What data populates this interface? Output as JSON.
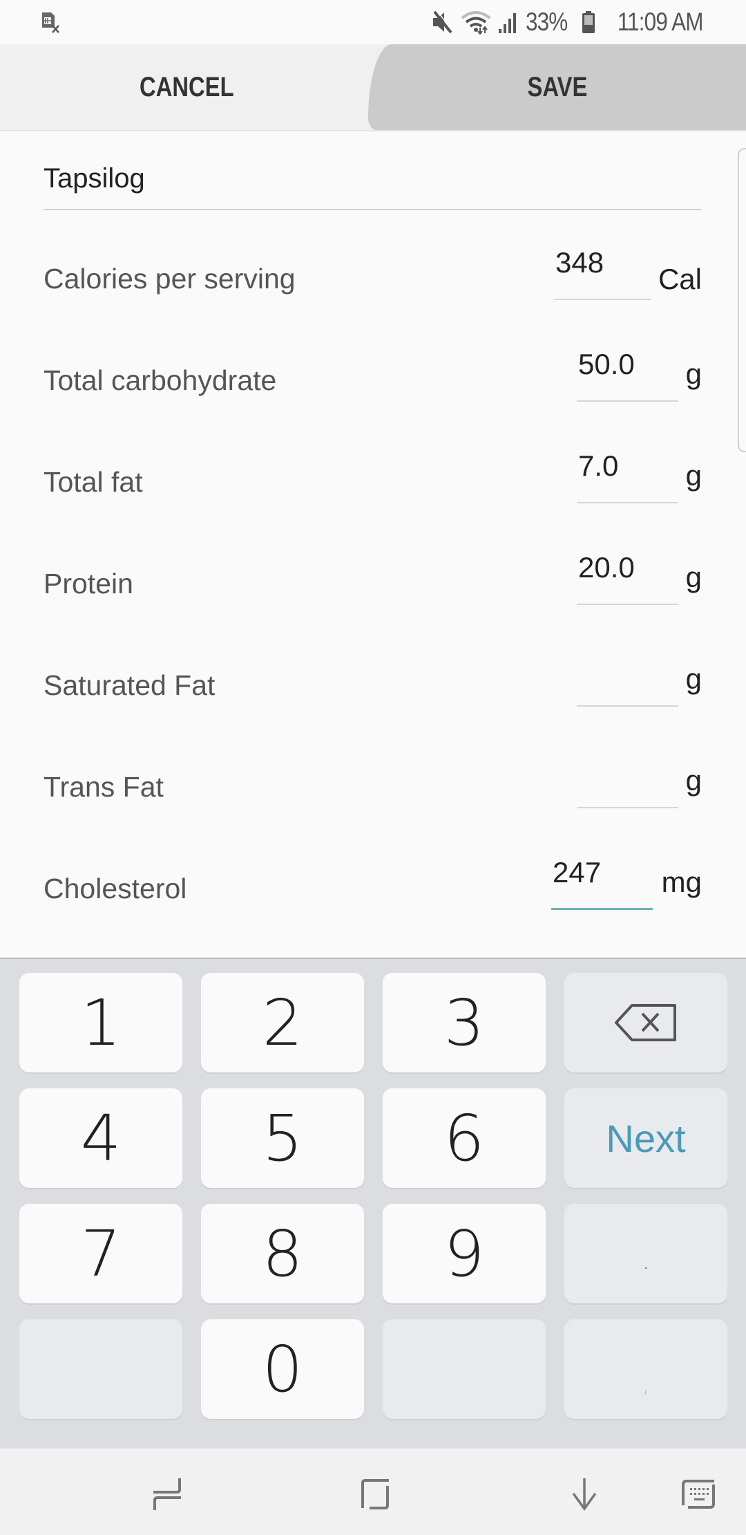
{
  "status_bar": {
    "notification_icon": "sim-card-x-icon",
    "mute_icon": "mute-icon",
    "wifi_icon": "wifi-icon",
    "signal_icon": "signal-icon",
    "battery_percent": "33%",
    "battery_icon": "battery-icon",
    "time": "11:09 AM"
  },
  "action_bar": {
    "cancel_label": "CANCEL",
    "save_label": "SAVE"
  },
  "form": {
    "food_name": "Tapsilog",
    "fields": [
      {
        "label": "Calories per serving",
        "value": "348",
        "unit": "Cal"
      },
      {
        "label": "Total carbohydrate",
        "value": "50.0",
        "unit": "g"
      },
      {
        "label": "Total fat",
        "value": "7.0",
        "unit": "g"
      },
      {
        "label": "Protein",
        "value": "20.0",
        "unit": "g"
      },
      {
        "label": "Saturated Fat",
        "value": "",
        "unit": "g"
      },
      {
        "label": "Trans Fat",
        "value": "",
        "unit": "g"
      },
      {
        "label": "Cholesterol",
        "value": "247",
        "unit": "mg",
        "focused": true
      }
    ]
  },
  "keyboard": {
    "keys": [
      "1",
      "2",
      "3",
      "4",
      "5",
      "6",
      "7",
      "8",
      "9",
      "0"
    ],
    "backspace_icon": "backspace-icon",
    "next_label": "Next",
    "dot_label": ".",
    "comma_label": ","
  },
  "nav_bar": {
    "recents_icon": "recents-icon",
    "home_icon": "home-icon",
    "back_icon": "hide-keyboard-icon",
    "keyboard_icon": "keyboard-switch-icon"
  },
  "colors": {
    "accent": "#6db5ad",
    "next_key": "#4a9bb8",
    "save_bg": "#cbcbcb",
    "keyboard_bg": "#dcdde0"
  }
}
